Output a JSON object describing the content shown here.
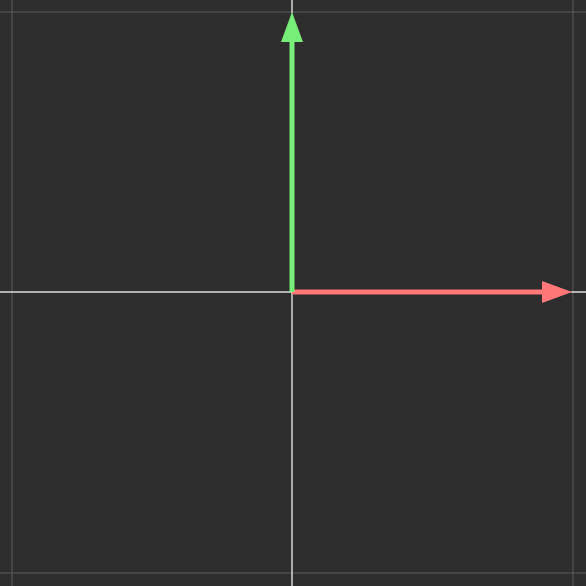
{
  "viewport": {
    "background": "#2d2d2d",
    "grid_color": "#5a5a5a",
    "axis_color": "#ffffff"
  },
  "vectors": [
    {
      "id": "x-basis",
      "x": 1,
      "y": 0,
      "color": "#ff7777"
    },
    {
      "id": "y-basis",
      "x": 0,
      "y": 1,
      "color": "#77ee77"
    }
  ]
}
